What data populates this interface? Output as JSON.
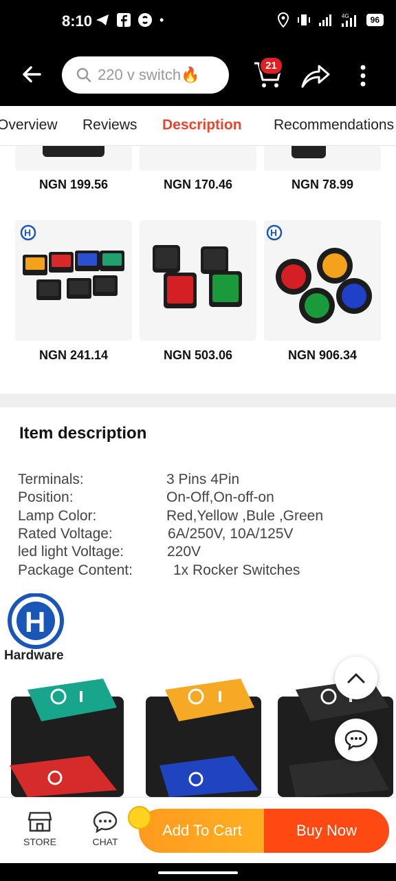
{
  "status_bar": {
    "time": "8:10",
    "battery": "96",
    "network": "4G"
  },
  "search": {
    "query": "220 v switch🔥"
  },
  "cart": {
    "count": "21"
  },
  "tabs": [
    "Overview",
    "Reviews",
    "Description",
    "Recommendations"
  ],
  "products_row1": [
    {
      "price": "NGN 199.56"
    },
    {
      "price": "NGN 170.46"
    },
    {
      "price": "NGN 78.99"
    }
  ],
  "products_row2": [
    {
      "price": "NGN 241.14",
      "brand": "Hardware"
    },
    {
      "price": "NGN 503.06"
    },
    {
      "price": "NGN 906.34",
      "brand": "Hardware"
    }
  ],
  "description": {
    "title": "Item description",
    "specs": [
      {
        "label": "Terminals:",
        "value": "3 Pins 4Pin"
      },
      {
        "label": "Position:",
        "value": "On-Off,On-off-on"
      },
      {
        "label": "Lamp Color:",
        "value": "Red,Yellow ,Bule ,Green"
      },
      {
        "label": "Rated Voltage:",
        "value": "6A/250V, 10A/125V"
      },
      {
        "label": "led light Voltage:",
        "value": "220V"
      },
      {
        "label": "Package Content:",
        "value": "1x Rocker Switches"
      }
    ],
    "brand": "Hardware"
  },
  "bottom": {
    "store": "STORE",
    "chat": "CHAT",
    "add_to_cart": "Add To Cart",
    "buy_now": "Buy Now"
  },
  "colors": {
    "accent": "#e8452c",
    "orange": "#ff9a1f",
    "buy": "#fe4a12"
  }
}
